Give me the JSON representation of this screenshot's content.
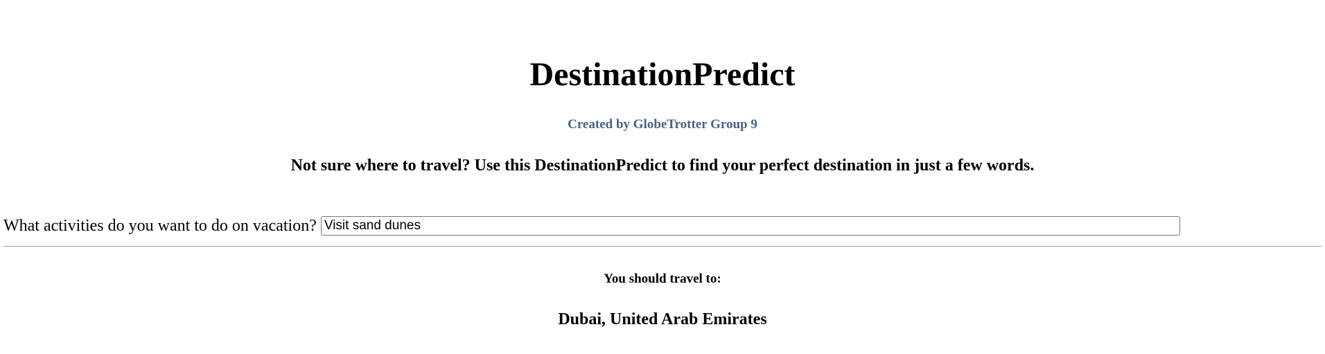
{
  "header": {
    "title": "DestinationPredict",
    "byline": "Created by GlobeTrotter Group 9",
    "tagline": "Not sure where to travel? Use this DestinationPredict to find your perfect destination in just a few words."
  },
  "form": {
    "question_label": "What activities do you want to do on vacation?",
    "activities_value": "Visit sand dunes"
  },
  "result": {
    "heading": "You should travel to:",
    "destination": "Dubai, United Arab Emirates"
  },
  "colors": {
    "byline": "#4a6380",
    "text": "#000000",
    "divider": "#a0a0a0"
  }
}
